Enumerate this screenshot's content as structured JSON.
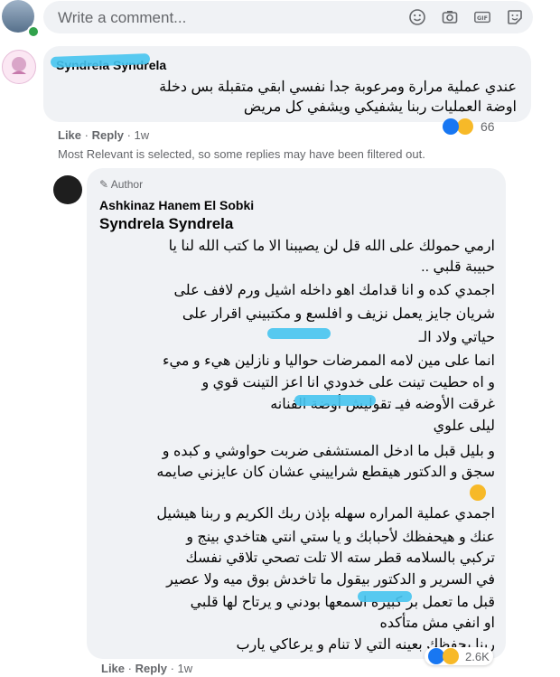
{
  "composer": {
    "placeholder": "Write a comment..."
  },
  "comment1": {
    "author": "Syndrela Syndrela",
    "lines": [
      "عندي عملية مرارة ومرعوبة جدا نفسي ابقي متقبلة بس دخلة",
      "اوضة العمليات ربنا يشفيكي ويشفي كل مريض"
    ],
    "like_label": "Like",
    "reply_label": "Reply",
    "time": "1w",
    "reaction_count": "66"
  },
  "filter_note": "Most Relevant is selected, so some replies may have been filtered out.",
  "reply": {
    "author_badge": "Author",
    "author": "Ashkinaz Hanem El Sobki",
    "mention": "Syndrela Syndrela",
    "lines": [
      "ارمي حمولك على الله قل لن يصيبنا الا ما كتب الله لنا يا",
      "حبيبة قلبي ..",
      "اجمدي كده و انا قدامك اهو داخله اشيل ورم لافف على",
      "شريان جايز يعمل نزيف و افلسع و مكتبيني اقرار على",
      "حياتي ولاد الـ",
      "انما على مين لامه الممرضات حواليا و نازلين هيء و ميء",
      "و اه حطيت تينت على خدودي انا اعز التينت قوي و",
      "غرقت الأوضه فيـ تقوليش أوضة الفنانه",
      "ليلى علوي",
      "و بليل قبل ما ادخل المستشفى ضربت حواوشي و كبده و",
      "سجق و الدكتور هيقطع شراييني عشان كان عايزني صايمه",
      "اجمدي عملية المراره سهله بإذن ربك الكريم و ربنا هيشيل",
      "عنك و هيحفظك لأحبابك و يا ستي انتي هتاخدي بينج و",
      "تركبي بالسلامه قطر سته الا تلت تصحي تلاقي نفسك",
      "في السرير و الدكتور بيقول ما تاخدش بوق ميه ولا عصير",
      "قبل ما تعمل بر كبيره اسمعها بودني و يرتاح لها قلبي",
      "او انفي مش متأكده",
      "ربنا يحفظك بعينه التي لا تنام و يرعاكي يارب"
    ],
    "like_label": "Like",
    "reply_label": "Reply",
    "time": "1w",
    "reaction_count": "2.6K"
  },
  "colors": {
    "meta_gray": "#65676b",
    "bubble": "#f0f2f5",
    "like_blue": "#1877f2",
    "haha_yellow": "#f7b928",
    "heart_red": "#f33e58"
  }
}
